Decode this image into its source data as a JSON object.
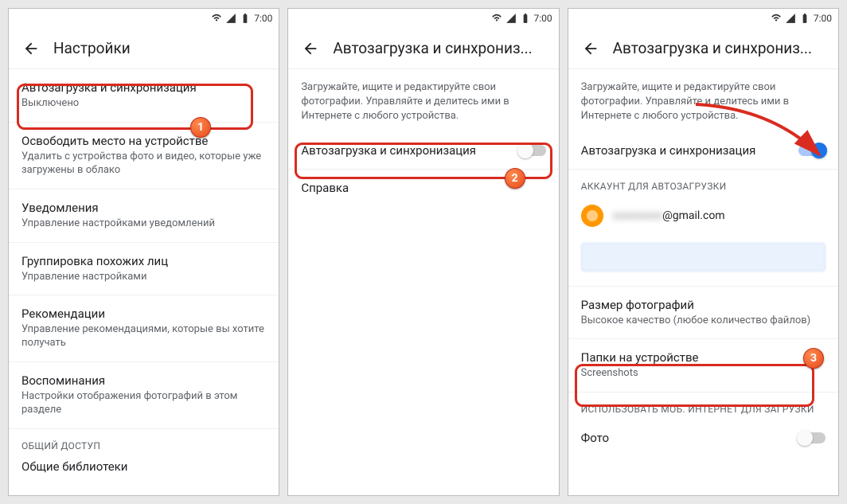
{
  "statusbar": {
    "time": "7:00"
  },
  "screen1": {
    "title": "Настройки",
    "items": [
      {
        "title": "Автозагрузка и синхронизация",
        "sub": "Выключено"
      },
      {
        "title": "Освободить место на устройстве",
        "sub": "Удалить с устройства фото и видео, которые уже загружены в облако"
      },
      {
        "title": "Уведомления",
        "sub": "Управление настройками уведомлений"
      },
      {
        "title": "Группировка похожих лиц",
        "sub": "Управление настройками"
      },
      {
        "title": "Рекомендации",
        "sub": "Управление рекомендациями, которые вы хотите получать"
      },
      {
        "title": "Воспоминания",
        "sub": "Настройки отображения фотографий в этом разделе"
      }
    ],
    "section": "ОБЩИЙ ДОСТУП",
    "shared": "Общие библиотеки"
  },
  "screen2": {
    "title": "Автозагрузка и синхрониз...",
    "desc": "Загружайте, ищите и редактируйте свои фотографии. Управляйте и делитесь ими в Интернете с любого устройства.",
    "toggleLabel": "Автозагрузка и синхронизация",
    "help": "Справка"
  },
  "screen3": {
    "title": "Автозагрузка и синхрониз...",
    "desc": "Загружайте, ищите и редактируйте свои фотографии. Управляйте и делитесь ими в Интернете с любого устройства.",
    "toggleLabel": "Автозагрузка и синхронизация",
    "accountHeader": "АККАУНТ ДЛЯ АВТОЗАГРУЗКИ",
    "emailBlur": "xxxxxxxxx",
    "emailDomain": "@gmail.com",
    "sizeTitle": "Размер фотографий",
    "sizeSub": "Высокое качество (любое количество файлов)",
    "foldersTitle": "Папки на устройстве",
    "foldersSub": "Screenshots",
    "mobileHeader": "ИСПОЛЬЗОВАТЬ МОБ. ИНТЕРНЕТ ДЛЯ ЗАГРУЗКИ",
    "photoLabel": "Фото"
  },
  "badges": {
    "b1": "1",
    "b2": "2",
    "b3": "3"
  }
}
